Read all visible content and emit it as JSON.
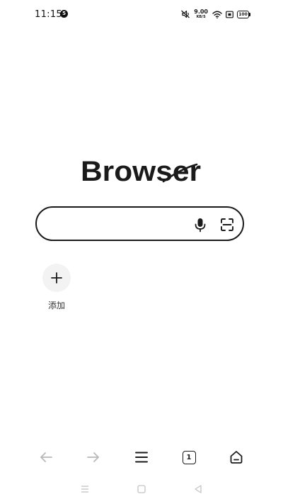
{
  "status_bar": {
    "time": "11:15",
    "notification_badge": "5",
    "net_speed_value": "9.00",
    "net_speed_unit": "KB/S",
    "battery": "100"
  },
  "logo": {
    "text": "Browser"
  },
  "search": {
    "value": "",
    "placeholder": ""
  },
  "shortcuts": [
    {
      "label": "添加",
      "icon": "plus-icon"
    }
  ],
  "toolbar": {
    "tab_count": "1",
    "buttons": [
      "back-icon",
      "forward-icon",
      "menu-icon",
      "tabs-icon",
      "home-icon"
    ],
    "disabled_color": "#b8b8b8",
    "active_color": "#1a1a1a"
  },
  "system_nav": {
    "buttons": [
      "recent-apps-icon",
      "home-square-icon",
      "back-triangle-icon"
    ],
    "color": "#c4c4c4"
  }
}
